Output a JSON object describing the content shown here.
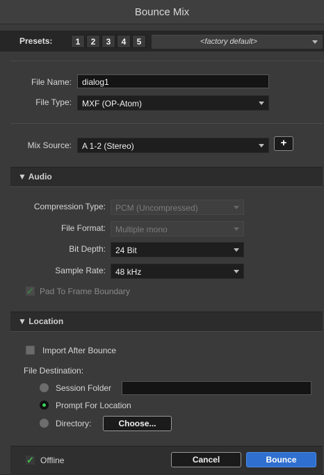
{
  "window": {
    "title": "Bounce Mix"
  },
  "presets": {
    "label": "Presets:",
    "buttons": [
      "1",
      "2",
      "3",
      "4",
      "5"
    ],
    "menu_value": "<factory default>"
  },
  "file": {
    "name_label": "File Name:",
    "name_value": "dialog1",
    "type_label": "File Type:",
    "type_value": "MXF (OP-Atom)"
  },
  "mix_source": {
    "label": "Mix Source:",
    "value": "A 1-2 (Stereo)",
    "add_label": "+"
  },
  "audio": {
    "header": "▼ Audio",
    "compression_label": "Compression Type:",
    "compression_value": "PCM (Uncompressed)",
    "format_label": "File Format:",
    "format_value": "Multiple mono",
    "bitdepth_label": "Bit Depth:",
    "bitdepth_value": "24 Bit",
    "samplerate_label": "Sample Rate:",
    "samplerate_value": "48 kHz",
    "pad_label": "Pad To Frame Boundary"
  },
  "location": {
    "header": "▼ Location",
    "import_label": "Import After Bounce",
    "dest_label": "File Destination:",
    "session_label": "Session Folder",
    "session_value": "",
    "prompt_label": "Prompt For Location",
    "directory_label": "Directory:",
    "choose_label": "Choose..."
  },
  "footer": {
    "offline_label": "Offline",
    "cancel_label": "Cancel",
    "bounce_label": "Bounce"
  },
  "colors": {
    "accent": "#2f6fcf",
    "check": "#3ec44a",
    "radio_on": "#35d35a"
  }
}
